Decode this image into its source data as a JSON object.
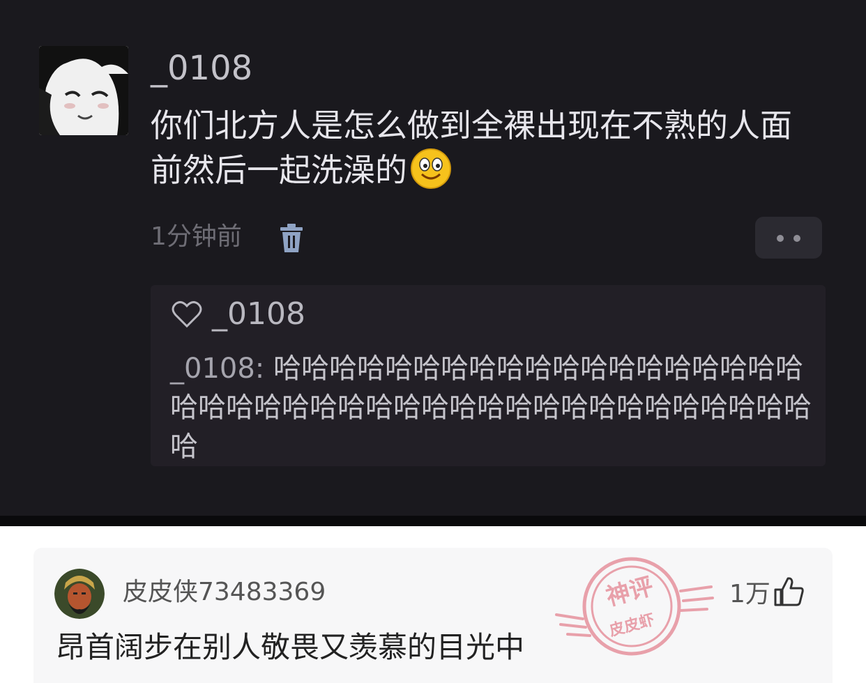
{
  "post": {
    "username": "_0108",
    "comment": "你们北方人是怎么做到全裸出现在不熟的人面前然后一起洗澡的",
    "emoji": "smiling-face-emoji",
    "time": "1分钟前"
  },
  "reply": {
    "username": "_0108",
    "prefix": "_0108:",
    "text": "哈哈哈哈哈哈哈哈哈哈哈哈哈哈哈哈哈哈哈哈哈哈哈哈哈哈哈哈哈哈哈哈哈哈哈哈哈哈哈哈哈哈哈"
  },
  "god_comment": {
    "username": "皮皮侠73483369",
    "likes": "1万",
    "text": "昂首阔步在别人敬畏又羡慕的目光中",
    "stamp_top": "神评",
    "stamp_bottom": "皮皮虾"
  },
  "colors": {
    "dark_bg": "#1a191e",
    "reply_bg": "#221f26",
    "card_bg": "#f7f7f8",
    "stamp": "#e8a0aa"
  }
}
